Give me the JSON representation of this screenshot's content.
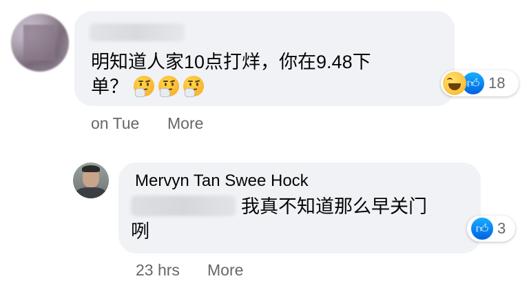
{
  "comment1": {
    "text_line1": "明知道人家10点打烊，你在9.48下",
    "text_line2": "单？",
    "emojis": [
      "thinking-face-icon",
      "thinking-face-icon",
      "thinking-face-icon"
    ],
    "reaction_count": "18",
    "reactions": [
      "laugh-icon",
      "like-icon"
    ],
    "time": "on Tue",
    "more_label": "More"
  },
  "comment2": {
    "author": "Mervyn Tan Swee Hock",
    "text_line1": "我真不知道那么早关门",
    "text_line2": "咧",
    "reaction_count": "3",
    "reactions": [
      "like-icon"
    ],
    "time": "23 hrs",
    "more_label": "More"
  },
  "colors": {
    "bubble_bg": "#f0f2f5",
    "meta_text": "#65676b",
    "like_blue": "#0062e0"
  }
}
